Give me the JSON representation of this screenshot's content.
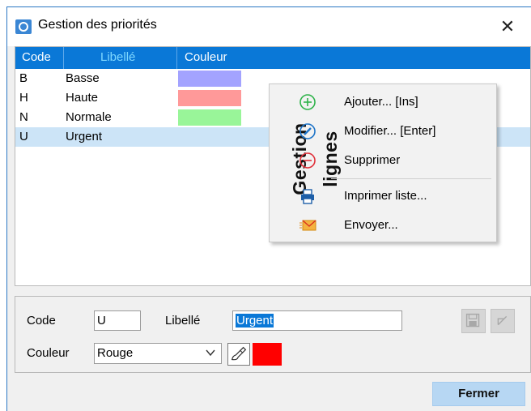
{
  "window": {
    "title": "Gestion des priorités",
    "close_symbol": "✕"
  },
  "grid": {
    "columns": [
      "Code",
      "Libellé",
      "Couleur"
    ],
    "rows": [
      {
        "code": "B",
        "libelle": "Basse",
        "color": "#a3a3ff"
      },
      {
        "code": "H",
        "libelle": "Haute",
        "color": "#ff9999"
      },
      {
        "code": "N",
        "libelle": "Normale",
        "color": "#99f599"
      },
      {
        "code": "U",
        "libelle": "Urgent",
        "color": ""
      }
    ],
    "selected_index": 3
  },
  "context_menu": {
    "side_title": "Gestion lignes",
    "items": [
      {
        "label": "Ajouter... [Ins]",
        "icon": "add-icon"
      },
      {
        "label": "Modifier... [Enter]",
        "icon": "edit-icon"
      },
      {
        "label": "Supprimer",
        "icon": "remove-icon"
      },
      {
        "label": "Imprimer liste...",
        "icon": "printer-icon"
      },
      {
        "label": "Envoyer...",
        "icon": "mail-icon"
      }
    ]
  },
  "form": {
    "code_label": "Code",
    "code_value": "U",
    "libelle_label": "Libellé",
    "libelle_value": "Urgent",
    "couleur_label": "Couleur",
    "couleur_value": "Rouge",
    "couleur_swatch": "#ff0000"
  },
  "buttons": {
    "close_label": "Fermer"
  },
  "colors": {
    "accent": "#0a78d7",
    "selection": "#cce4f7"
  }
}
